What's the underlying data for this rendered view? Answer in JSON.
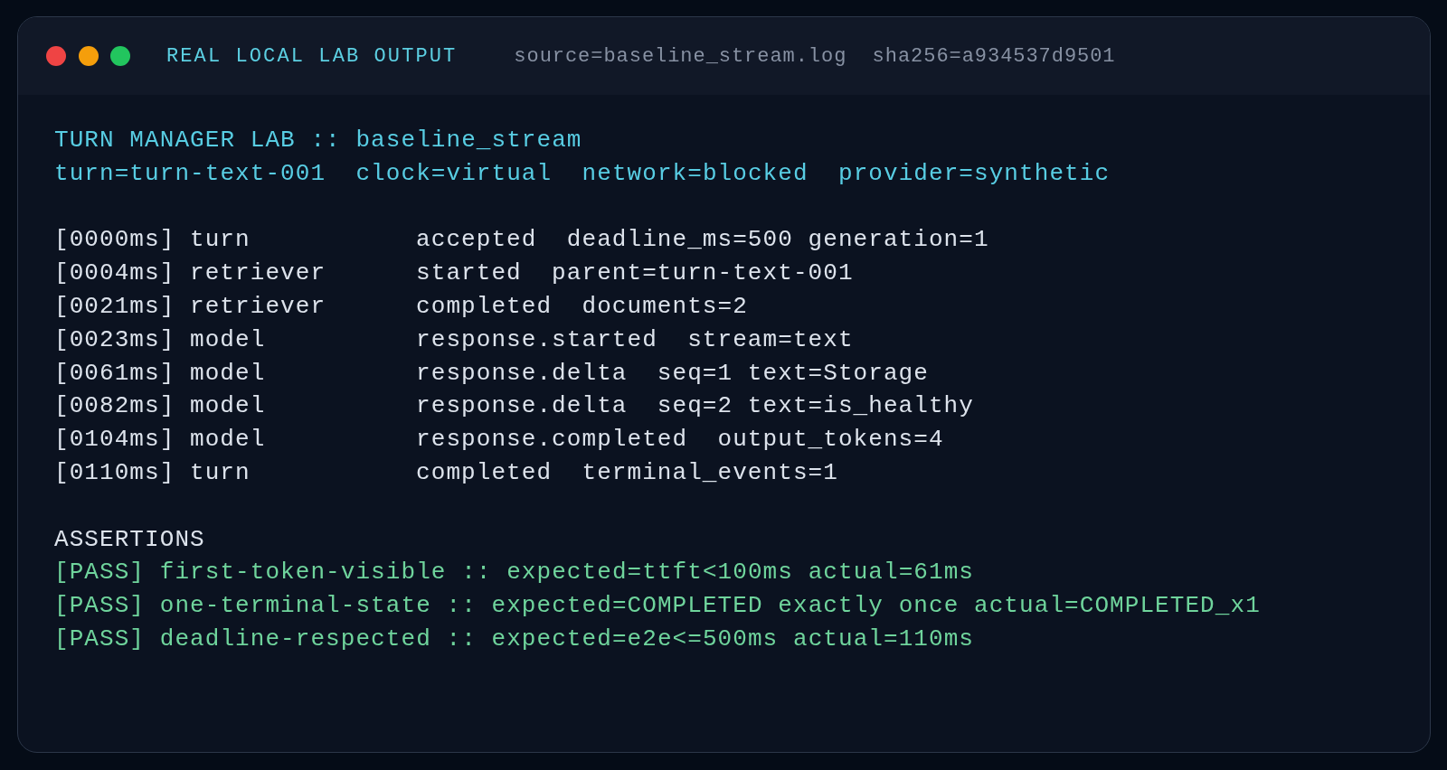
{
  "window": {
    "title": "REAL LOCAL LAB OUTPUT",
    "source": "source=baseline_stream.log  sha256=a934537d9501"
  },
  "header": {
    "title": "TURN MANAGER LAB :: baseline_stream",
    "parameters": "turn=turn-text-001  clock=virtual  network=blocked  provider=synthetic"
  },
  "events": [
    {
      "time": "[0000ms]",
      "component": "turn",
      "message": "accepted  deadline_ms=500 generation=1"
    },
    {
      "time": "[0004ms]",
      "component": "retriever",
      "message": "started  parent=turn-text-001"
    },
    {
      "time": "[0021ms]",
      "component": "retriever",
      "message": "completed  documents=2"
    },
    {
      "time": "[0023ms]",
      "component": "model",
      "message": "response.started  stream=text"
    },
    {
      "time": "[0061ms]",
      "component": "model",
      "message": "response.delta  seq=1 text=Storage"
    },
    {
      "time": "[0082ms]",
      "component": "model",
      "message": "response.delta  seq=2 text=is_healthy"
    },
    {
      "time": "[0104ms]",
      "component": "model",
      "message": "response.completed  output_tokens=4"
    },
    {
      "time": "[0110ms]",
      "component": "turn",
      "message": "completed  terminal_events=1"
    }
  ],
  "assertions": {
    "heading": "ASSERTIONS",
    "items": [
      {
        "text": "[PASS] first-token-visible :: expected=ttft<100ms actual=61ms",
        "passed": true
      },
      {
        "text": "[PASS] one-terminal-state :: expected=COMPLETED exactly once actual=COMPLETED_x1",
        "passed": true
      },
      {
        "text": "[PASS] deadline-respected :: expected=e2e<=500ms actual=110ms",
        "passed": true
      }
    ]
  }
}
